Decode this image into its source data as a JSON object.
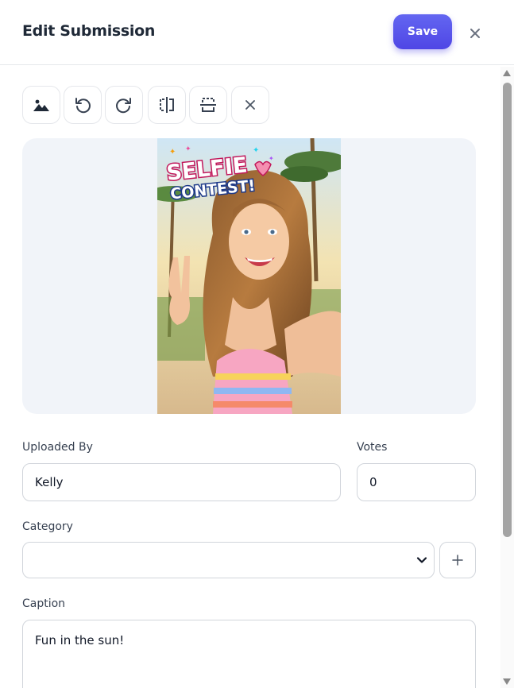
{
  "header": {
    "title": "Edit Submission",
    "save_label": "Save",
    "close_icon": "close-icon"
  },
  "toolbar": {
    "tools": [
      {
        "name": "image-icon"
      },
      {
        "name": "rotate-left-icon"
      },
      {
        "name": "rotate-right-icon"
      },
      {
        "name": "flip-horizontal-icon"
      },
      {
        "name": "flip-vertical-icon"
      },
      {
        "name": "clear-icon"
      }
    ]
  },
  "image": {
    "overlay_line1": "SELFIE",
    "overlay_line2": "CONTEST!"
  },
  "form": {
    "uploaded_by_label": "Uploaded By",
    "uploaded_by_value": "Kelly",
    "votes_label": "Votes",
    "votes_value": "0",
    "category_label": "Category",
    "category_value": "",
    "caption_label": "Caption",
    "caption_value": "Fun in the sun!"
  },
  "colors": {
    "accent": "#4f46e5",
    "image_bg": "#f1f4f9",
    "border": "#d1d5db"
  }
}
